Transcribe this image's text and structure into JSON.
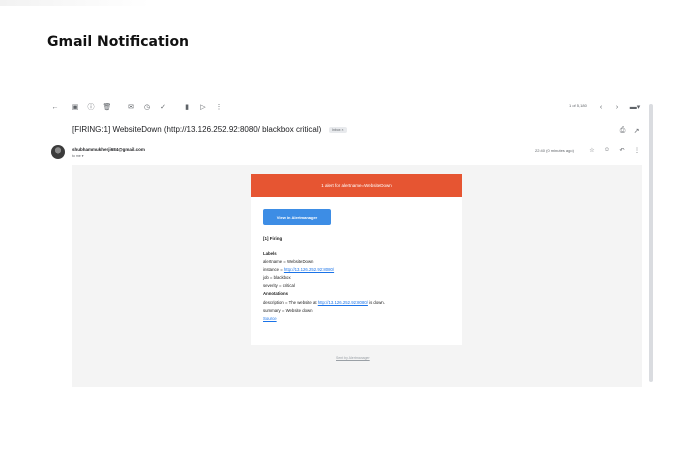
{
  "doc_title": "Gmail Notification",
  "toolbar": {
    "icons": [
      "back-icon",
      "archive-icon",
      "report-spam-icon",
      "delete-icon",
      "mark-unread-icon",
      "snooze-icon",
      "add-task-icon",
      "move-to-icon",
      "label-icon",
      "more-icon"
    ],
    "pager": "1 of 5,180"
  },
  "email": {
    "subject": "[FIRING:1] WebsiteDown (http://13.126.252.92:8080/ blackbox critical)",
    "inbox_label": "Inbox ×",
    "sender": "shubhammukherji684@gmail.com",
    "to_label": "to me ▾",
    "time": "22:40 (0 minutes ago)"
  },
  "body": {
    "banner": "1 alert for alertname=WebsiteDown",
    "button": "View in Alertmanager",
    "firing_heading": "[1] Firing",
    "labels_heading": "Labels",
    "alertname": "alertname = WebsiteDown",
    "instance_prefix": "instance = ",
    "instance_link": "http://13.126.252.92:8080/",
    "job": "job = blackbox",
    "severity": "severity = critical",
    "annotations_heading": "Annotations",
    "description_prefix": "description = The website at ",
    "description_link": "http://13.126.252.92:8080/",
    "description_suffix": " is down.",
    "summary": "summary = Website down",
    "source_link": "Source",
    "footer_link": "Sent by Alertmanager"
  }
}
